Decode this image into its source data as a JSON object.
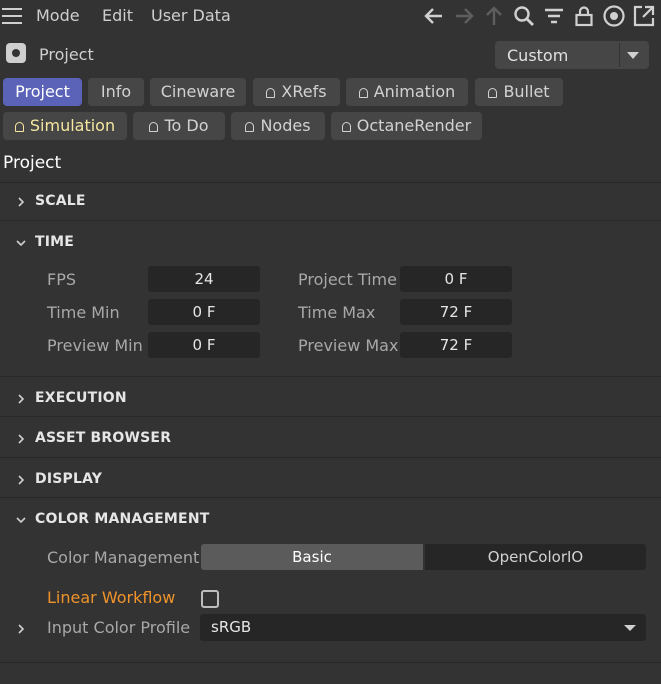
{
  "menu": {
    "items": [
      "Mode",
      "Edit",
      "User Data"
    ]
  },
  "toolbar": {
    "icons": [
      "back-arrow-icon",
      "forward-arrow-icon",
      "up-arrow-icon",
      "search-icon",
      "filter-icon",
      "lock-icon",
      "target-icon",
      "new-window-icon"
    ]
  },
  "object": {
    "title": "Project",
    "preset": "Custom"
  },
  "tabs": {
    "row1": [
      "Project",
      "Info",
      "Cineware",
      "XRefs",
      "Animation",
      "Bullet"
    ],
    "row2": [
      "Simulation",
      "To Do",
      "Nodes",
      "OctaneRender"
    ]
  },
  "section_title": "Project",
  "groups": {
    "scale": "SCALE",
    "time": "TIME",
    "execution": "EXECUTION",
    "asset_browser": "ASSET BROWSER",
    "display": "DISPLAY",
    "color_management": "COLOR MANAGEMENT"
  },
  "time": {
    "fps_label": "FPS",
    "fps": "24",
    "project_time_label": "Project Time",
    "project_time": "0 F",
    "time_min_label": "Time Min",
    "time_min": "0 F",
    "time_max_label": "Time Max",
    "time_max": "72 F",
    "preview_min_label": "Preview Min",
    "preview_min": "0 F",
    "preview_max_label": "Preview Max",
    "preview_max": "72 F"
  },
  "color": {
    "mode_label": "Color Management",
    "mode_options": [
      "Basic",
      "OpenColorIO"
    ],
    "linear_label": "Linear Workflow",
    "profile_label": "Input Color Profile",
    "profile_value": "sRGB"
  },
  "colors": {
    "accent": "#5a63b8",
    "highlight": "#f0932a",
    "panel": "#333333",
    "field": "#262626"
  }
}
